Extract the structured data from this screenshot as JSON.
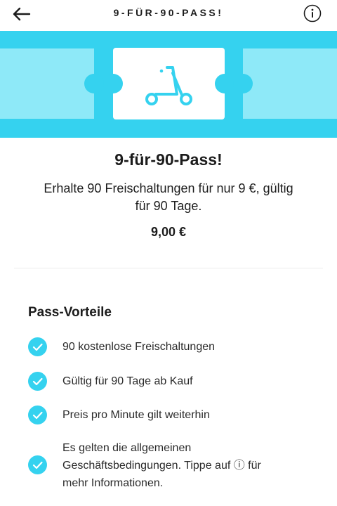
{
  "header": {
    "title": "9-FÜR-90-PASS!",
    "back_icon": "arrow-left-icon",
    "info_icon": "info-circle-icon"
  },
  "banner": {
    "icon": "scooter-icon",
    "colors": {
      "dark": "#35d2ef",
      "light": "#8ee9f8",
      "ticket": "#ffffff"
    }
  },
  "pass": {
    "title": "9-für-90-Pass!",
    "description_line1": "Erhalte 90 Freischaltungen für nur 9 €, gültig",
    "description_line2": "für 90 Tage.",
    "price": "9,00 €"
  },
  "benefits": {
    "heading": "Pass-Vorteile",
    "items": [
      {
        "text": "90 kostenlose Freischaltungen"
      },
      {
        "text": "Gültig für 90 Tage ab Kauf"
      },
      {
        "text": "Preis pro Minute gilt weiterhin"
      },
      {
        "line1": "Es gelten die allgemeinen",
        "line2": "Geschäftsbedingungen. Tippe auf ⓘ für",
        "line3": "mehr Informationen."
      }
    ]
  },
  "colors": {
    "accent": "#35d2ef"
  }
}
